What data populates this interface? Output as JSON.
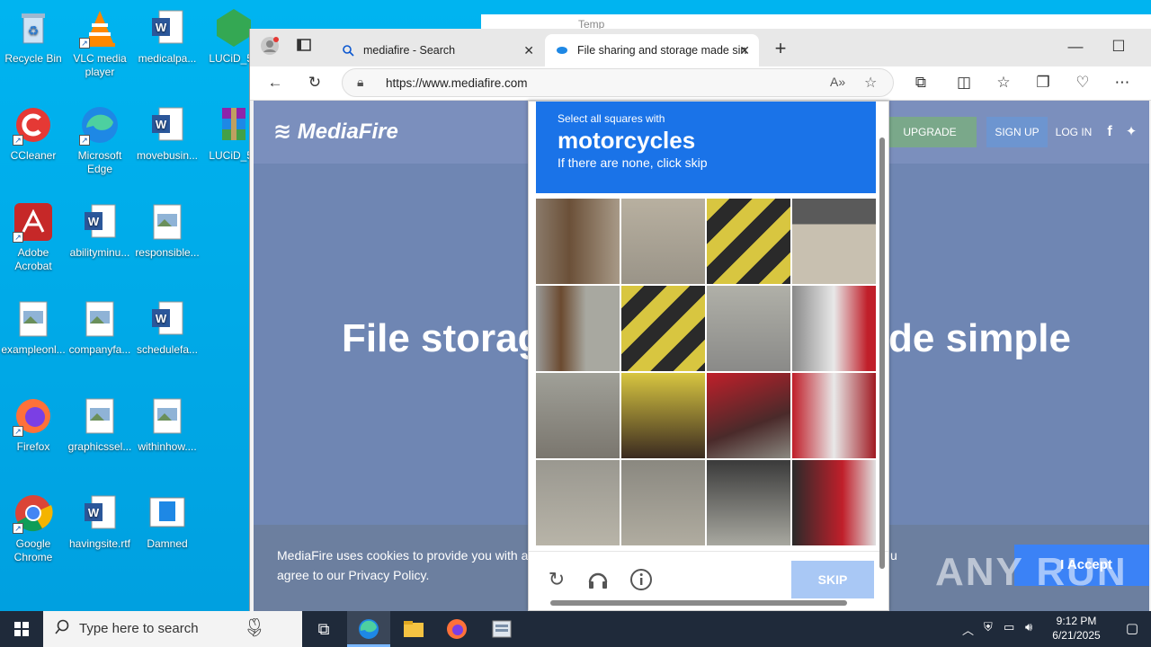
{
  "desktop": {
    "icons": [
      {
        "label": "Recycle Bin"
      },
      {
        "label": "VLC media player"
      },
      {
        "label": "medicalpa..."
      },
      {
        "label": "LUCiD_5e"
      },
      {
        "label": "CCleaner"
      },
      {
        "label": "Microsoft Edge"
      },
      {
        "label": "movebusin..."
      },
      {
        "label": "LUCiD_5e"
      },
      {
        "label": "Adobe Acrobat"
      },
      {
        "label": "abilityminu..."
      },
      {
        "label": "responsible..."
      },
      {
        "label": "exampleonl..."
      },
      {
        "label": "companyfa..."
      },
      {
        "label": "schedulefa..."
      },
      {
        "label": "Firefox"
      },
      {
        "label": "graphicssel..."
      },
      {
        "label": "withinhow...."
      },
      {
        "label": "Google Chrome"
      },
      {
        "label": "havingsite.rtf"
      },
      {
        "label": "Damned"
      }
    ]
  },
  "bg_window": {
    "title": "Temp"
  },
  "browser": {
    "tabs": [
      {
        "label": "mediafire - Search"
      },
      {
        "label": "File sharing and storage made sin"
      }
    ],
    "url": "https://www.mediafire.com"
  },
  "mediafire": {
    "logo": "MediaFire",
    "upgrade": "UPGRADE",
    "signup": "SIGN UP",
    "login": "LOG IN",
    "hero_left": "File storag",
    "hero_right": "de simple",
    "cookie_line1": "MediaFire uses cookies to provide you with a p",
    "cookie_line1_tail": "u",
    "cookie_line2": "agree to our Privacy Policy.",
    "accept": "I Accept"
  },
  "captcha": {
    "instruction": "Select all squares with",
    "target": "motorcycles",
    "hint": "If there are none, click skip",
    "skip": "SKIP"
  },
  "taskbar": {
    "search_placeholder": "Type here to search",
    "time": "9:12 PM",
    "date": "6/21/2025"
  },
  "watermark": "ANY RUN",
  "colors": {
    "desktop": "#00a8e8",
    "captcha_blue": "#1a73e8",
    "skip": "#a9c8f5",
    "page_overlay": "#6f86b3"
  }
}
